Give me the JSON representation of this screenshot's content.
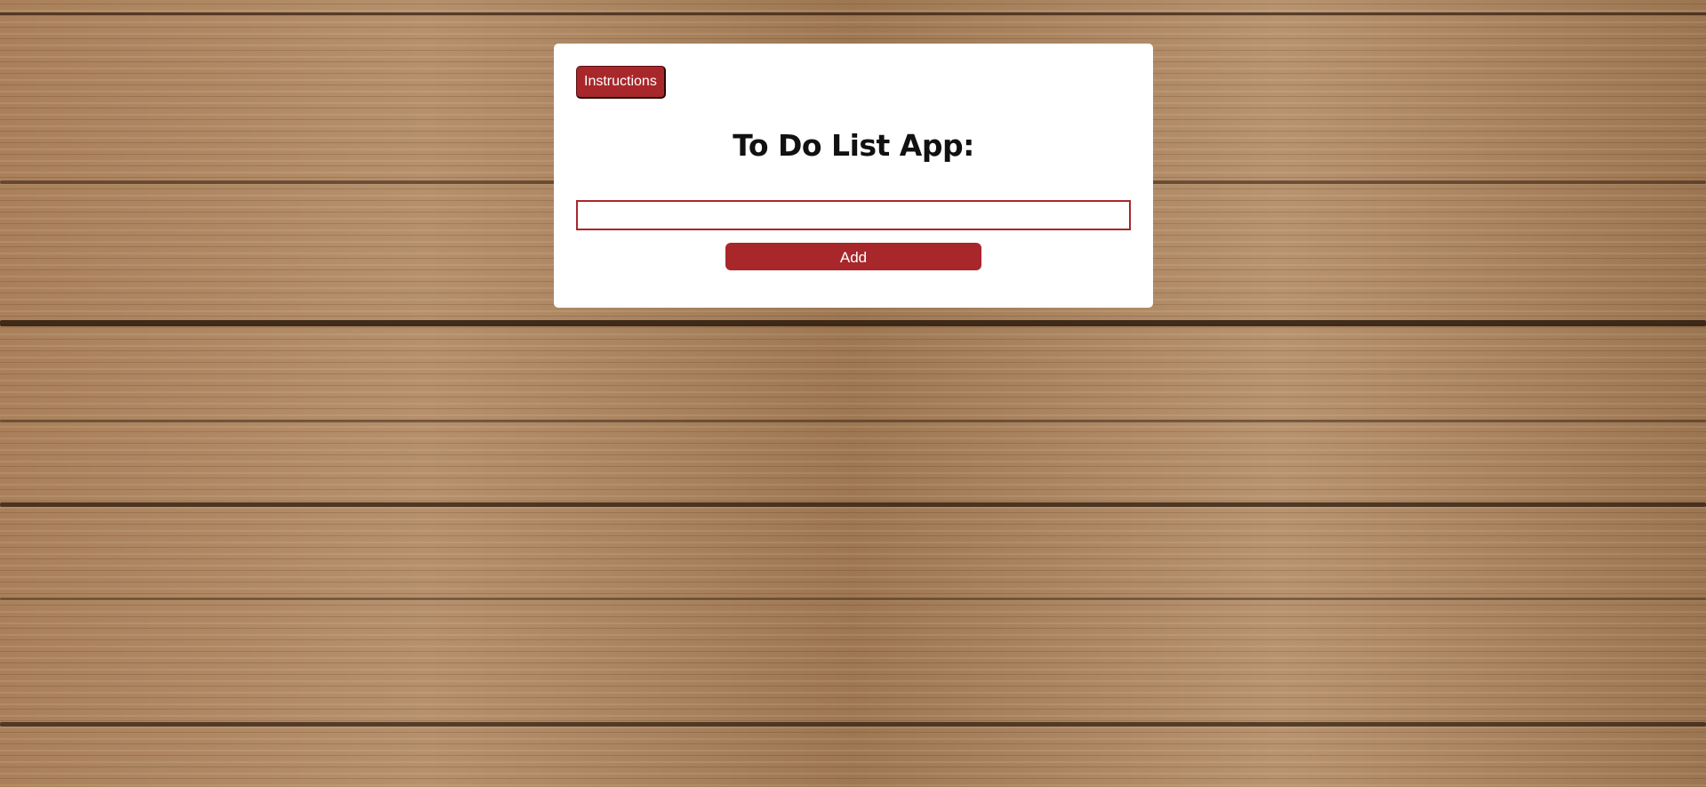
{
  "app": {
    "title": "To Do List App:"
  },
  "toolbar": {
    "instructions_label": "Instructions"
  },
  "task_input": {
    "value": "",
    "placeholder": ""
  },
  "actions": {
    "add_label": "Add"
  },
  "colors": {
    "accent": "#a8272b",
    "card_background": "#ffffff",
    "page_background": "#a9805a"
  }
}
